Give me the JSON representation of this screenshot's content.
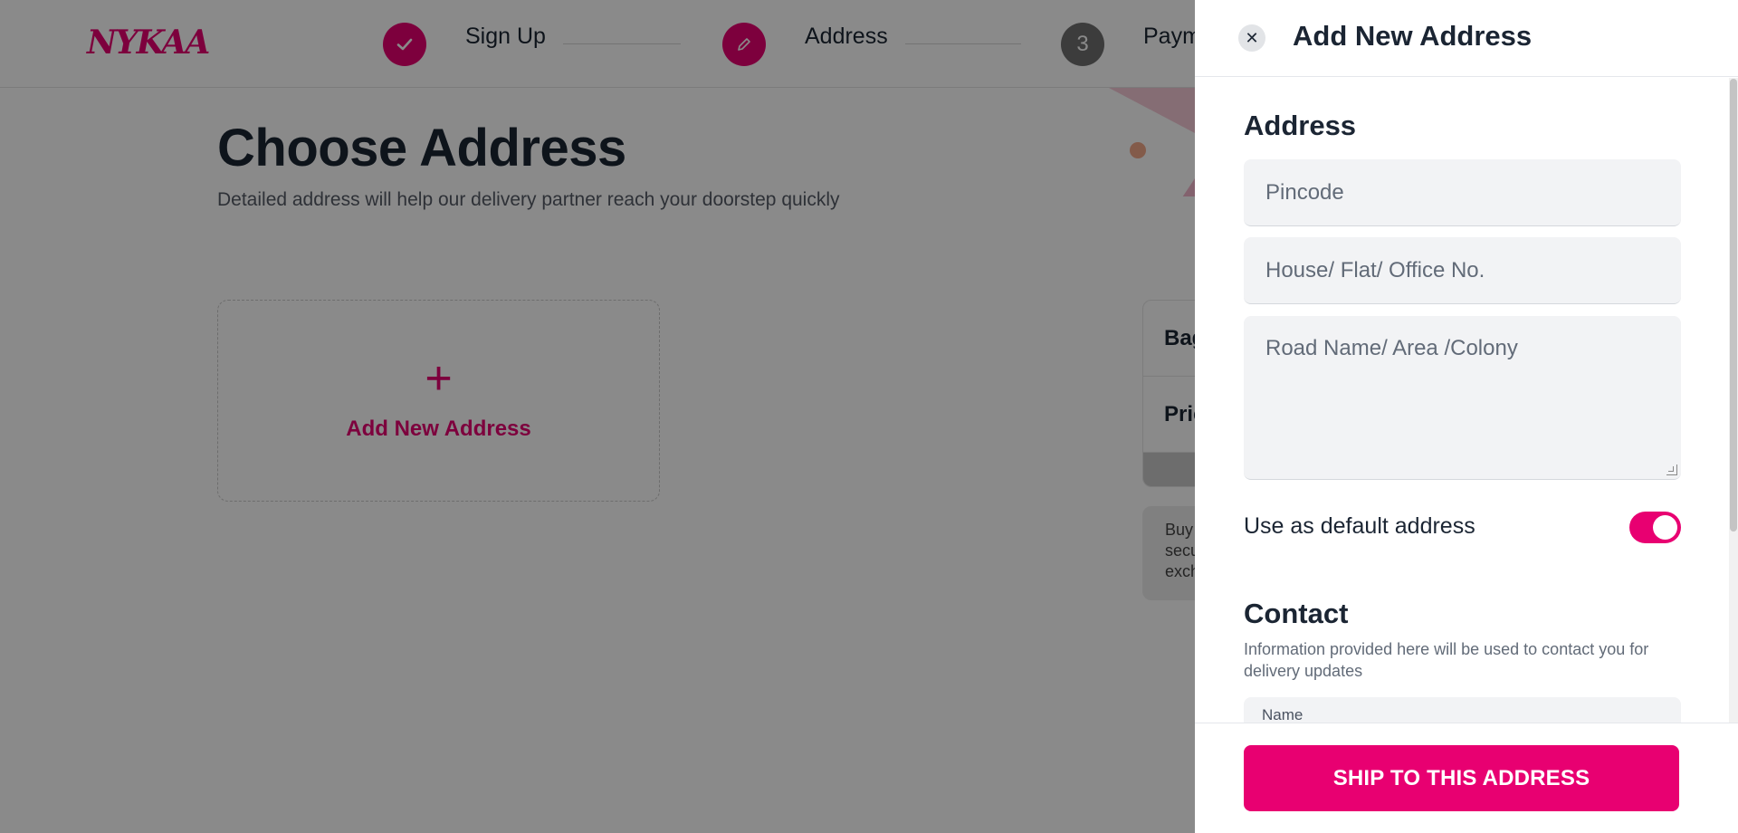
{
  "brand": {
    "logo_text": "NYKAA",
    "accent": "#e80071"
  },
  "stepper": {
    "steps": [
      {
        "label": "Sign Up",
        "state": "completed",
        "icon": "check-icon"
      },
      {
        "label": "Address",
        "state": "current",
        "icon": "pencil-icon"
      },
      {
        "label": "Payment",
        "state": "pending",
        "number": "3"
      }
    ]
  },
  "main": {
    "title": "Choose Address",
    "subtitle": "Detailed address will help our delivery partner reach your doorstep quickly",
    "add_card": {
      "icon": "plus-icon",
      "label": "Add New Address"
    }
  },
  "summary": {
    "rows": [
      "Bag",
      "Price"
    ],
    "promo_lines": [
      "Buy",
      "secu",
      "exch"
    ]
  },
  "drawer": {
    "title": "Add New Address",
    "close_icon": "close-icon",
    "address_section": {
      "title": "Address",
      "pincode_placeholder": "Pincode",
      "house_placeholder": "House/ Flat/ Office No.",
      "road_placeholder": "Road Name/ Area /Colony"
    },
    "default_toggle": {
      "label": "Use as default address",
      "checked": true
    },
    "contact_section": {
      "title": "Contact",
      "subtitle": "Information provided here will be used to contact you for delivery updates",
      "name_label": "Name"
    },
    "submit_label": "SHIP TO THIS ADDRESS"
  }
}
